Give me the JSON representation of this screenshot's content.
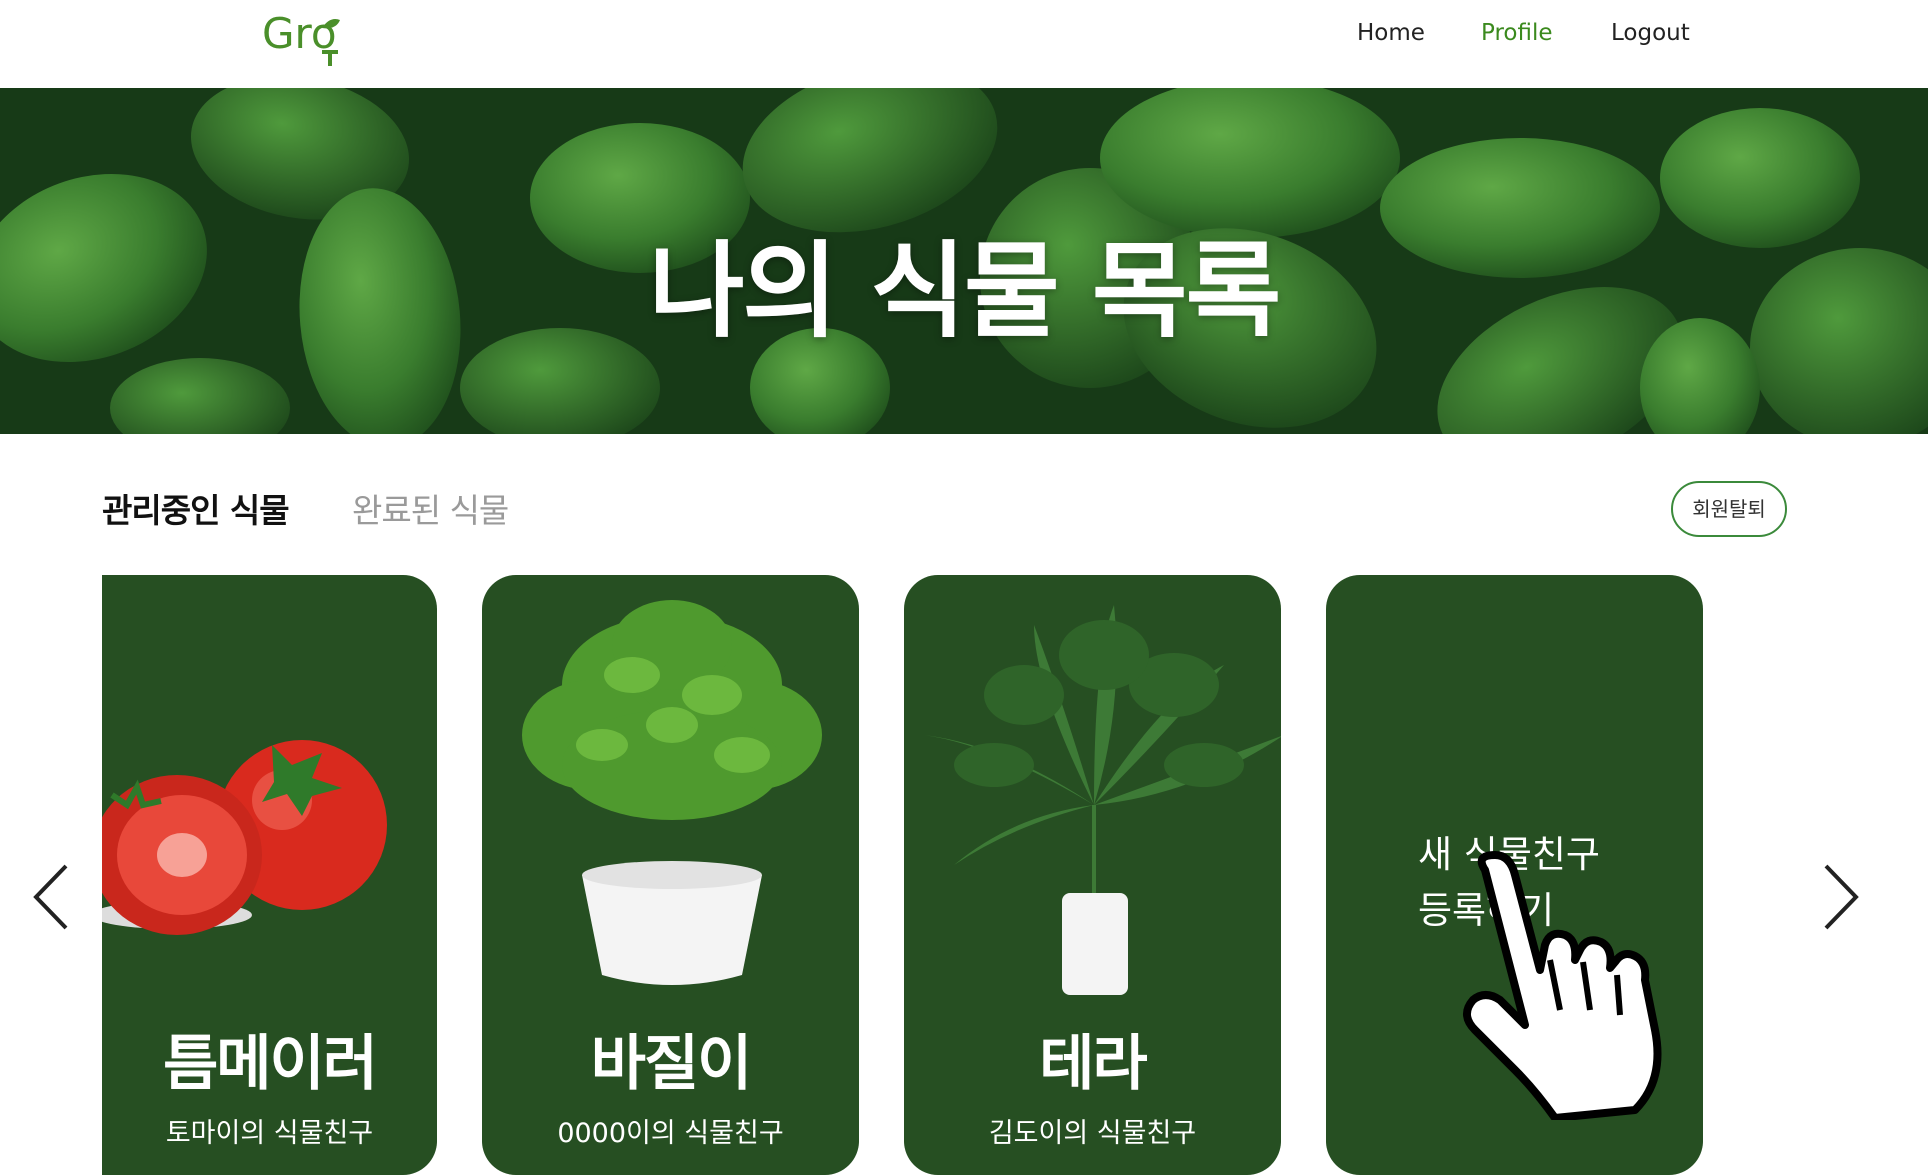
{
  "header": {
    "logo_text": "Gro",
    "nav": {
      "home": "Home",
      "profile": "Profile",
      "logout": "Logout"
    }
  },
  "hero": {
    "title": "나의 식물 목록"
  },
  "tabs": {
    "active": "관리중인 식물",
    "inactive": "완료된 식물"
  },
  "withdraw_button": "회원탈퇴",
  "cards": [
    {
      "name": "틈메이러",
      "subtitle": "토마이의 식물친구"
    },
    {
      "name": "바질이",
      "subtitle": "0000이의 식물친구"
    },
    {
      "name": "테라",
      "subtitle": "김도이의 식물친구"
    }
  ],
  "new_card": {
    "line1": "새 식물친구",
    "line2": "등록하기"
  },
  "colors": {
    "accent": "#3b8a1e",
    "card_bg": "#264f22"
  }
}
